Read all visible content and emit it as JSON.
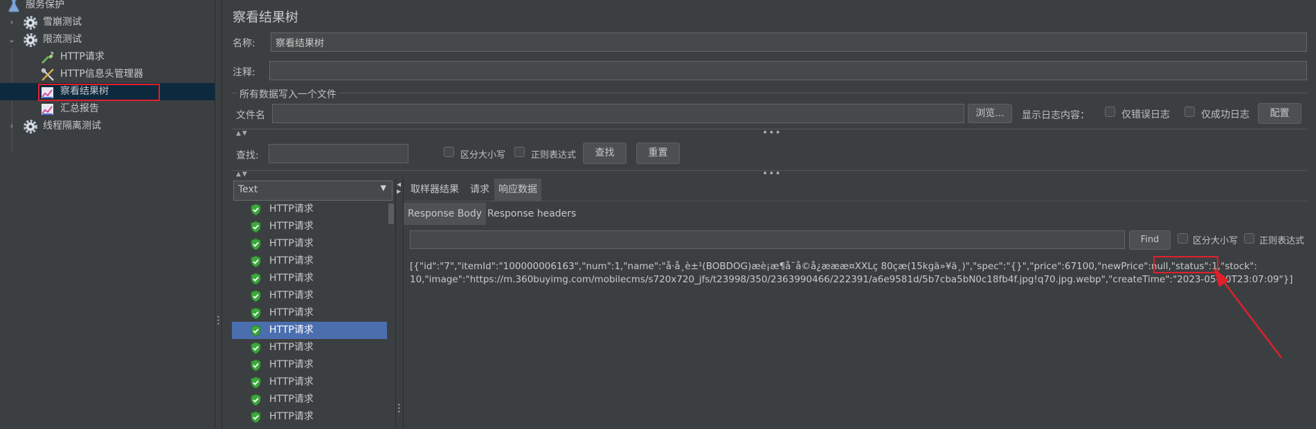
{
  "tree": {
    "items": [
      {
        "label": "服务保护",
        "icon": "flask-icon"
      },
      {
        "label": "雪崩测试",
        "icon": "gear-icon",
        "chevron": "›"
      },
      {
        "label": "限流测试",
        "icon": "gear-icon",
        "chevron": "⌄"
      },
      {
        "label": "HTTP请求",
        "icon": "pipette-icon"
      },
      {
        "label": "HTTP信息头管理器",
        "icon": "tools-icon"
      },
      {
        "label": "察看结果树",
        "icon": "chart-icon"
      },
      {
        "label": "汇总报告",
        "icon": "chart-icon"
      },
      {
        "label": "线程隔离测试",
        "icon": "gear-icon",
        "chevron": "›"
      }
    ]
  },
  "panel": {
    "title": "察看结果树",
    "name_label": "名称:",
    "name_value": "察看结果树",
    "comment_label": "注释:",
    "comment_value": "",
    "file_section": "所有数据写入一个文件",
    "filename_label": "文件名",
    "filename_value": "",
    "browse_button": "浏览...",
    "log_label": "显示日志内容：",
    "errors_only": "仅错误日志",
    "success_only": "仅成功日志",
    "config_button": "配置",
    "search_label": "查找:",
    "search_value": "",
    "case_sensitive": "区分大小写",
    "regex": "正则表达式",
    "find_button": "查找",
    "reset_button": "重置"
  },
  "renderer": {
    "selected": "Text"
  },
  "results": {
    "items": [
      "HTTP请求",
      "HTTP请求",
      "HTTP请求",
      "HTTP请求",
      "HTTP请求",
      "HTTP请求",
      "HTTP请求",
      "HTTP请求",
      "HTTP请求",
      "HTTP请求",
      "HTTP请求",
      "HTTP请求",
      "HTTP请求"
    ],
    "selected_index": 7
  },
  "tabs": {
    "sampler": "取样器结果",
    "request": "请求",
    "response": "响应数据"
  },
  "subtabs": {
    "body": "Response Body",
    "headers": "Response headers"
  },
  "response_search": {
    "value": "",
    "find_button": "Find",
    "case_sensitive": "区分大小写",
    "regex": "正则表达式"
  },
  "response": {
    "line1": "[{\"id\":\"7\",\"itemId\":\"100000006163\",\"num\":1,\"name\":\"å·å¸è±¹(BOBDOG)æè¡æ¶å¨å©å¿æææ¤XXLç 80çæ(15kgä»¥ä¸)\",\"spec\":\"{}\",\"price\":67100,\"newPrice\":null,\"status\":1,\"stock\":",
    "line2": "10,\"image\":\"https://m.360buyimg.com/mobilecms/s720x720_jfs/t23998/350/2363990466/222391/a6e9581d/5b7cba5bN0c18fb4f.jpg!q70.jpg.webp\",\"createTime\":\"2023-05-20T23:07:09\"}]"
  },
  "colors": {
    "background": "#3c3f41",
    "selection": "#4b6eaf",
    "highlight": "#e0202b",
    "shield": "#3ea83e"
  }
}
